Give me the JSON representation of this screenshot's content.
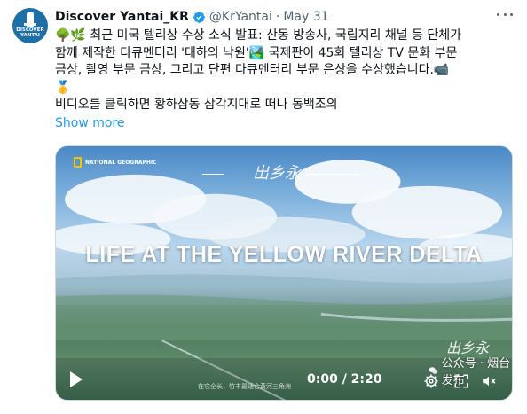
{
  "account": {
    "avatar_text": "DISCOVER YANTAI",
    "display_name": "Discover Yantai_KR",
    "handle": "@KrYantai",
    "separator": "·",
    "date": "May 31",
    "verified_color": "#1d9bf0"
  },
  "tweet": {
    "line1": "🌳🌿 최근 미국 텔리상 수상 소식 발표: 산동 방송사, 국립지리 채널 등 단체가",
    "line2": "함께 제작한 다큐멘터리 '대하의 낙원'🏞️ 국제판이 45회 텔리상 TV 문화 부문",
    "line3": "금상, 촬영 부문 금상, 그리고 단편 다큐멘터리 부문 은상을 수상했습니다.📹",
    "line4": "🥇",
    "line5": "비디오를 클릭하면 황하삼동 삼각지대로 떠나 동백조의",
    "show_more": "Show more"
  },
  "video": {
    "channel_logo_text": "NATIONAL GEOGRAPHIC",
    "calligraphy_text": "出乡永",
    "title": "LIFE AT THE YELLOW RIVER DELTA",
    "subtitle_text": "在它全长，竹丰最适合黄河三角洲",
    "time": "0:00 / 2:20",
    "watermark_text": "公众号 · 烟台发布"
  },
  "colors": {
    "link": "#1d9bf0",
    "text": "#0f1419",
    "muted": "#536471"
  }
}
